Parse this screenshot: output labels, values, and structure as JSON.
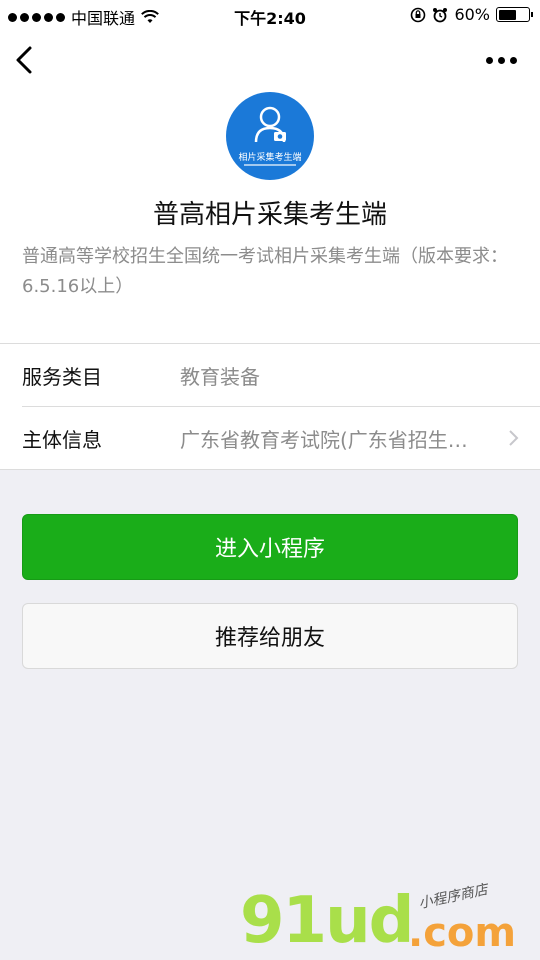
{
  "status_bar": {
    "carrier": "中国联通",
    "time": "下午2:40",
    "battery_text": "60%",
    "battery_level": 0.6,
    "icons": [
      "signal-dots-icon",
      "wifi-icon",
      "orientation-lock-icon",
      "alarm-icon",
      "battery-icon"
    ]
  },
  "nav": {
    "back_icon": "chevron-left-icon",
    "more_icon": "more-dots-icon"
  },
  "app": {
    "logo_text": "相片采集考生端",
    "title": "普高相片采集考生端",
    "description": "普通高等学校招生全国统一考试相片采集考生端（版本要求：6.5.16以上）"
  },
  "info_rows": [
    {
      "label": "服务类目",
      "value": "教育装备"
    },
    {
      "label": "主体信息",
      "value": "广东省教育考试院(广东省招生…"
    }
  ],
  "buttons": {
    "enter_label": "进入小程序",
    "share_label": "推荐给朋友"
  },
  "watermark": {
    "main": "91ud",
    "domain": ".com",
    "tagline": "小程序商店"
  },
  "colors": {
    "primary_green": "#1aad19",
    "logo_blue": "#1b79d8",
    "background": "#efeff4"
  }
}
